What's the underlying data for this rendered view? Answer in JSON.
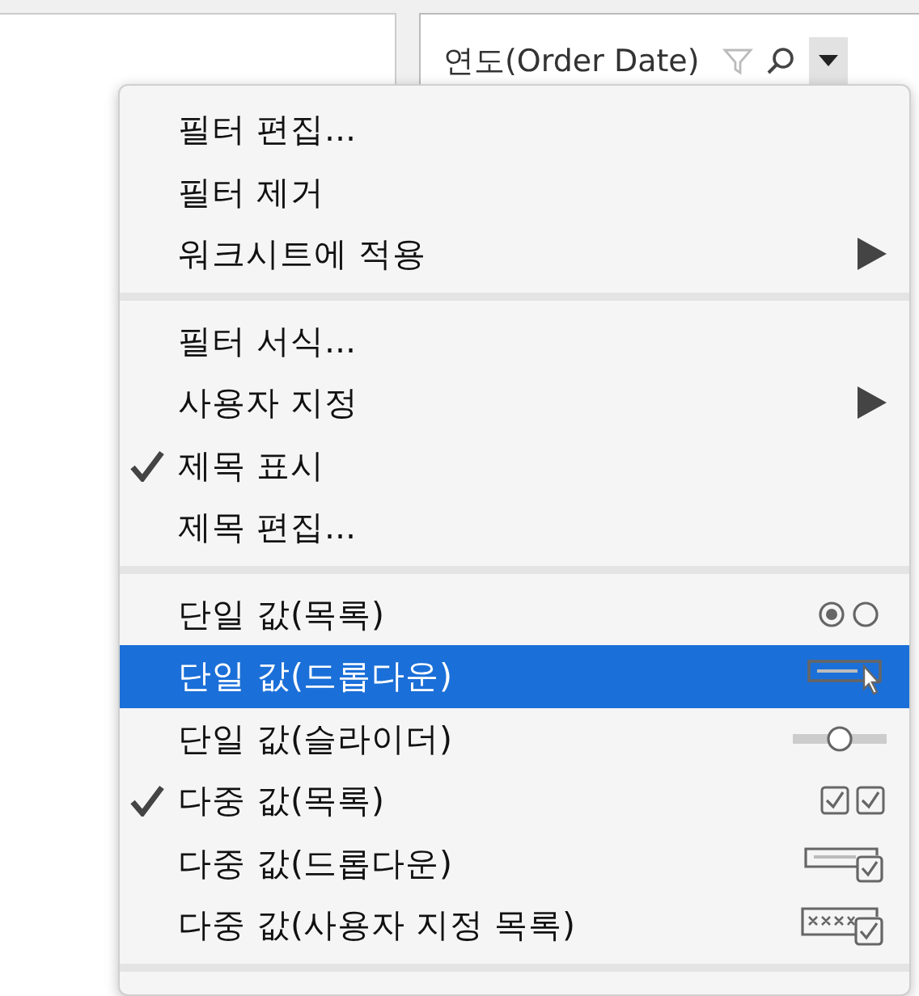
{
  "filter_card": {
    "title": "연도(Order Date)"
  },
  "menu": {
    "sections": [
      [
        {
          "label": "필터 편집...",
          "checked": false,
          "selected": false,
          "submenu": false
        },
        {
          "label": "필터 제거",
          "checked": false,
          "selected": false,
          "submenu": false
        },
        {
          "label": "워크시트에 적용",
          "checked": false,
          "selected": false,
          "submenu": true
        }
      ],
      [
        {
          "label": "필터 서식...",
          "checked": false,
          "selected": false,
          "submenu": false
        },
        {
          "label": "사용자 지정",
          "checked": false,
          "selected": false,
          "submenu": true
        },
        {
          "label": "제목 표시",
          "checked": true,
          "selected": false,
          "submenu": false
        },
        {
          "label": "제목 편집...",
          "checked": false,
          "selected": false,
          "submenu": false
        }
      ],
      [
        {
          "label": "단일 값(목록)",
          "checked": false,
          "selected": false,
          "submenu": false,
          "kind": "radio-list"
        },
        {
          "label": "단일 값(드롭다운)",
          "checked": false,
          "selected": true,
          "submenu": false,
          "kind": "single-dropdown"
        },
        {
          "label": "단일 값(슬라이더)",
          "checked": false,
          "selected": false,
          "submenu": false,
          "kind": "slider"
        },
        {
          "label": "다중 값(목록)",
          "checked": true,
          "selected": false,
          "submenu": false,
          "kind": "checkbox-list"
        },
        {
          "label": "다중 값(드롭다운)",
          "checked": false,
          "selected": false,
          "submenu": false,
          "kind": "multi-dropdown"
        },
        {
          "label": "다중 값(사용자 지정 목록)",
          "checked": false,
          "selected": false,
          "submenu": false,
          "kind": "custom-list"
        }
      ]
    ]
  }
}
